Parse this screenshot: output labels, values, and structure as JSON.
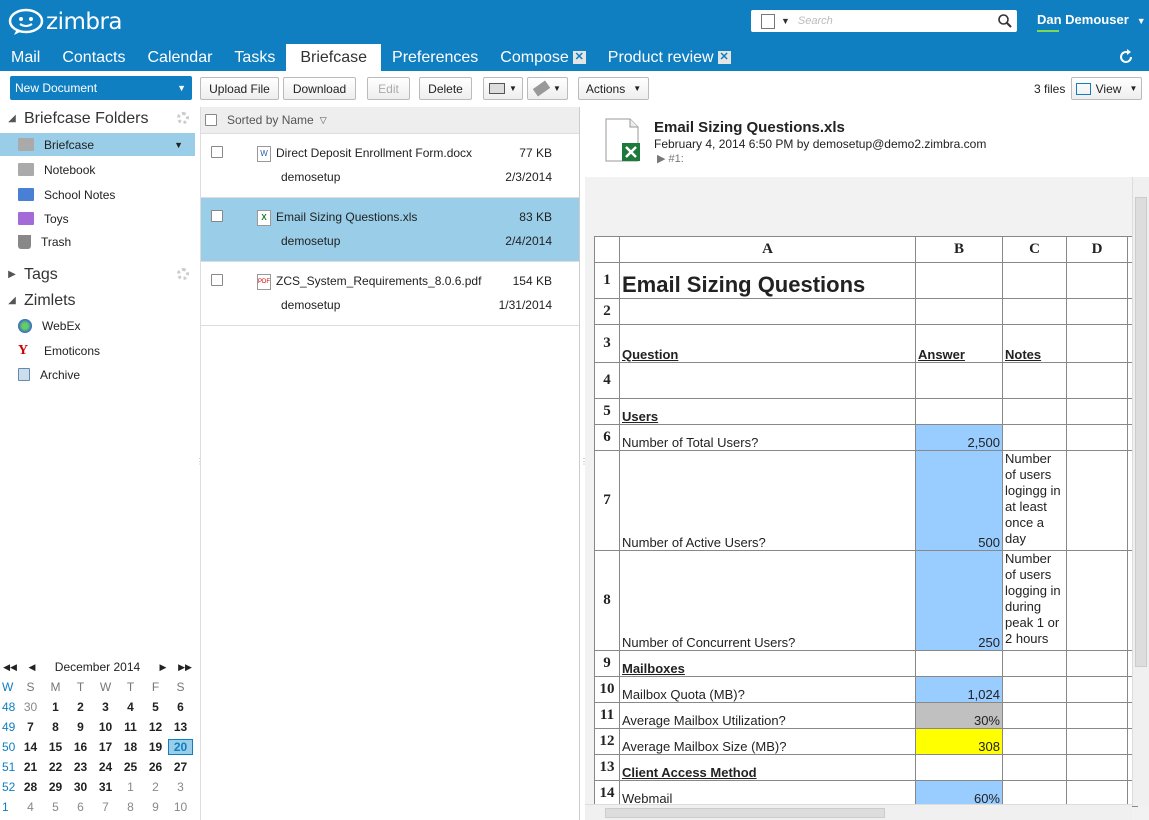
{
  "app": {
    "brand": "zimbra",
    "accent": "#0f7fc2"
  },
  "search": {
    "placeholder": "Search"
  },
  "user": {
    "name": "Dan Demouser"
  },
  "tabs": [
    {
      "label": "Mail"
    },
    {
      "label": "Contacts"
    },
    {
      "label": "Calendar"
    },
    {
      "label": "Tasks"
    },
    {
      "label": "Briefcase"
    },
    {
      "label": "Preferences"
    },
    {
      "label": "Compose"
    },
    {
      "label": "Product review"
    }
  ],
  "toolbar": {
    "new_document": "New Document",
    "upload": "Upload File",
    "download": "Download",
    "edit": "Edit",
    "delete": "Delete",
    "actions": "Actions",
    "file_count": "3 files",
    "view": "View"
  },
  "sidebar": {
    "folders_title": "Briefcase Folders",
    "folders": [
      {
        "label": "Briefcase",
        "color": "#aaaaaa"
      },
      {
        "label": "Notebook",
        "color": "#aaaaaa"
      },
      {
        "label": "School Notes",
        "color": "#4a7fd6"
      },
      {
        "label": "Toys",
        "color": "#a46bd8"
      },
      {
        "label": "Trash",
        "color": "#888888"
      }
    ],
    "tags_title": "Tags",
    "zimlets_title": "Zimlets",
    "zimlets": [
      {
        "label": "WebEx",
        "icon": "globe-icon"
      },
      {
        "label": "Emoticons",
        "icon": "yahoo-icon"
      },
      {
        "label": "Archive",
        "icon": "archive-icon"
      }
    ]
  },
  "calendar": {
    "month": "December 2014",
    "weekdays": [
      "W",
      "S",
      "M",
      "T",
      "W",
      "T",
      "F",
      "S"
    ],
    "weeks": [
      [
        "48",
        "30",
        "1",
        "2",
        "3",
        "4",
        "5",
        "6"
      ],
      [
        "49",
        "7",
        "8",
        "9",
        "10",
        "11",
        "12",
        "13"
      ],
      [
        "50",
        "14",
        "15",
        "16",
        "17",
        "18",
        "19",
        "20"
      ],
      [
        "51",
        "21",
        "22",
        "23",
        "24",
        "25",
        "26",
        "27"
      ],
      [
        "52",
        "28",
        "29",
        "30",
        "31",
        "1",
        "2",
        "3"
      ],
      [
        "1",
        "4",
        "5",
        "6",
        "7",
        "8",
        "9",
        "10"
      ]
    ],
    "today": "20"
  },
  "list": {
    "sort_label": "Sorted by Name",
    "items": [
      {
        "name": "Direct Deposit Enrollment Form.docx",
        "size": "77 KB",
        "owner": "demosetup",
        "date": "2/3/2014",
        "icon": "W"
      },
      {
        "name": "Email Sizing Questions.xls",
        "size": "83 KB",
        "owner": "demosetup",
        "date": "2/4/2014",
        "icon": "X"
      },
      {
        "name": "ZCS_System_Requirements_8.0.6.pdf",
        "size": "154 KB",
        "owner": "demosetup",
        "date": "1/31/2014",
        "icon": "PDF"
      }
    ]
  },
  "preview": {
    "title": "Email Sizing Questions.xls",
    "meta": "February 4, 2014 6:50 PM by demosetup@demo2.zimbra.com",
    "version": "▶ #1:",
    "columns": [
      "A",
      "B",
      "C",
      "D"
    ],
    "rows": [
      {
        "n": "1",
        "a": "Email Sizing Questions",
        "b": "",
        "c": ""
      },
      {
        "n": "2",
        "a": "",
        "b": "",
        "c": ""
      },
      {
        "n": "3",
        "a": "Question",
        "b": "Answer",
        "c": "Notes"
      },
      {
        "n": "4",
        "a": "",
        "b": "",
        "c": ""
      },
      {
        "n": "5",
        "a": "Users",
        "b": "",
        "c": ""
      },
      {
        "n": "6",
        "a": "Number of Total Users?",
        "b": "2,500",
        "c": ""
      },
      {
        "n": "7",
        "a": "Number of Active Users?",
        "b": "500",
        "c": "Number of users logingg in at least once a day"
      },
      {
        "n": "8",
        "a": "Number of Concurrent Users?",
        "b": "250",
        "c": "Number of users logging in during peak 1 or 2 hours"
      },
      {
        "n": "9",
        "a": "Mailboxes",
        "b": "",
        "c": ""
      },
      {
        "n": "10",
        "a": "Mailbox Quota (MB)?",
        "b": "1,024",
        "c": ""
      },
      {
        "n": "11",
        "a": "Average Mailbox Utilization?",
        "b": "30%",
        "c": ""
      },
      {
        "n": "12",
        "a": "Average Mailbox Size (MB)?",
        "b": "308",
        "c": ""
      },
      {
        "n": "13",
        "a": "Client Access Method",
        "b": "",
        "c": ""
      },
      {
        "n": "14",
        "a": "Webmail",
        "b": "60%",
        "c": ""
      }
    ]
  }
}
